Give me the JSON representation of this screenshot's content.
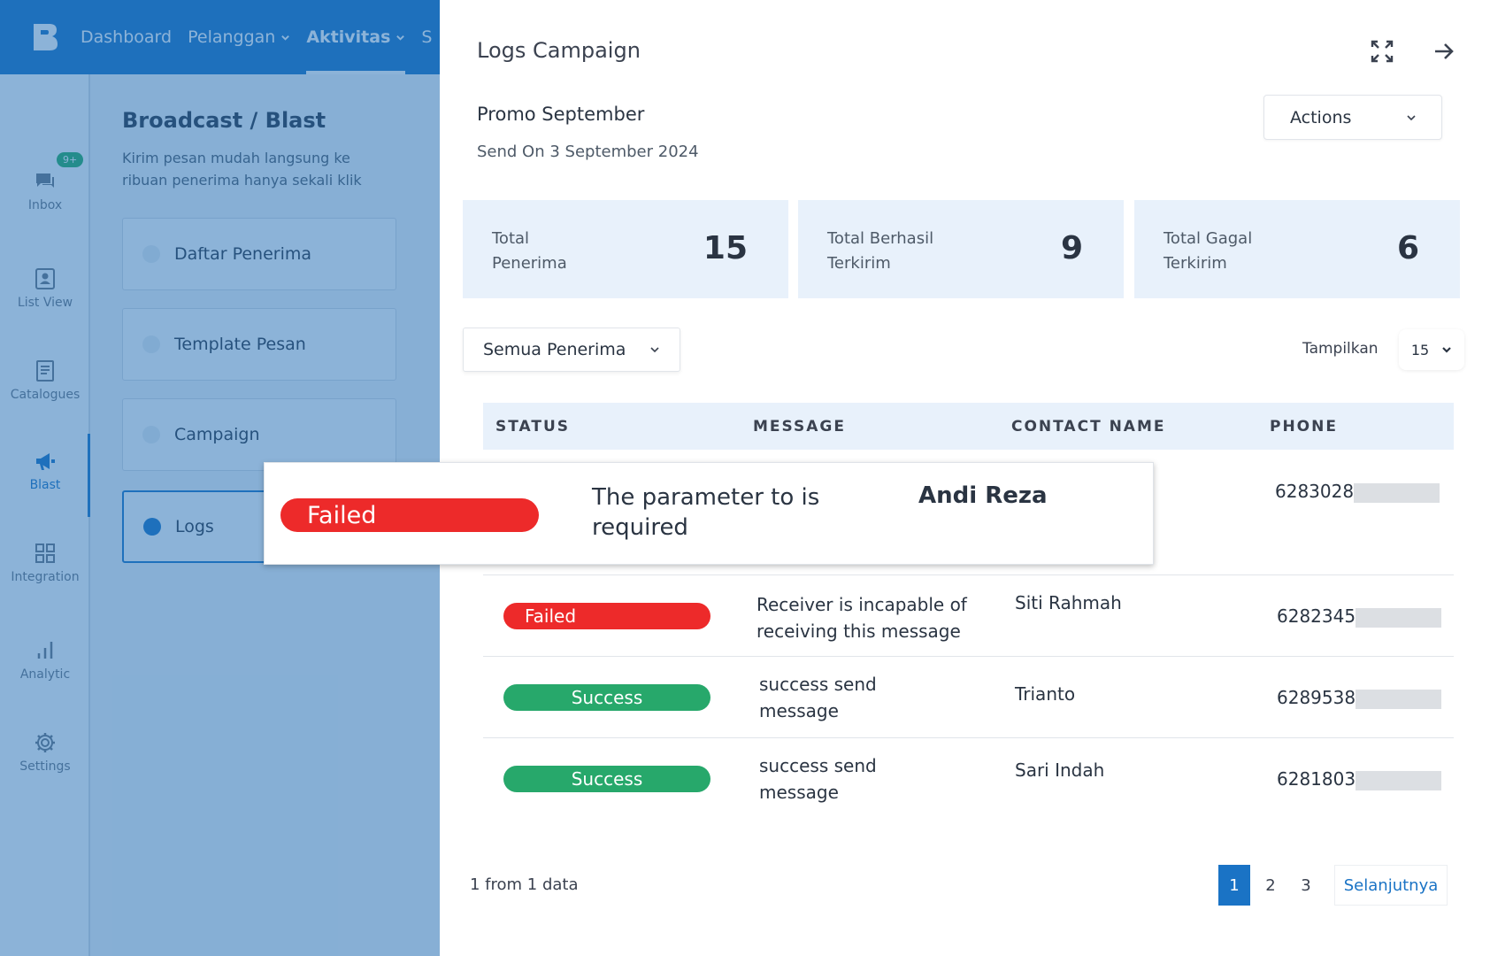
{
  "topbar": {
    "nav": [
      {
        "label": "Dashboard"
      },
      {
        "label": "Pelanggan"
      },
      {
        "label": "Aktivitas"
      },
      {
        "label": "S"
      }
    ]
  },
  "sidebar": {
    "items": [
      {
        "label": "Inbox",
        "icon": "chat-icon",
        "badge": "9+"
      },
      {
        "label": "List View",
        "icon": "contact-card-icon"
      },
      {
        "label": "Catalogues",
        "icon": "book-icon"
      },
      {
        "label": "Blast",
        "icon": "megaphone-icon"
      },
      {
        "label": "Integration",
        "icon": "grid-icon"
      },
      {
        "label": "Analytic",
        "icon": "bar-chart-icon"
      },
      {
        "label": "Settings",
        "icon": "gear-icon"
      }
    ]
  },
  "panel": {
    "title": "Broadcast / Blast",
    "description": "Kirim pesan mudah langsung ke ribuan penerima hanya sekali klik",
    "menu": [
      {
        "label": "Daftar Penerima"
      },
      {
        "label": "Template Pesan"
      },
      {
        "label": "Campaign"
      },
      {
        "label": "Logs"
      }
    ]
  },
  "drawer": {
    "title": "Logs Campaign",
    "campaign_name": "Promo September",
    "send_date": "Send On 3 September 2024",
    "actions_label": "Actions",
    "stats": [
      {
        "label_line1": "Total",
        "label_line2": "Penerima",
        "value": "15"
      },
      {
        "label_line1": "Total Berhasil",
        "label_line2": "Terkirim",
        "value": "9"
      },
      {
        "label_line1": "Total Gagal",
        "label_line2": "Terkirim",
        "value": "6"
      }
    ],
    "filter_label": "Semua Penerima",
    "tampilkan_label": "Tampilkan",
    "per_page": "15",
    "columns": [
      "STATUS",
      "MESSAGE",
      "CONTACT NAME",
      "PHONE"
    ],
    "rows": [
      {
        "status": "Failed",
        "message": "The parameter to is required",
        "contact": "Andi Reza",
        "phone": "6283028"
      },
      {
        "status": "Failed",
        "message": "Receiver is incapable of receiving this message",
        "contact": "Siti Rahmah",
        "phone": "6282345"
      },
      {
        "status": "Success",
        "message": "success send message",
        "contact": "Trianto",
        "phone": "6289538"
      },
      {
        "status": "Success",
        "message": "success send message",
        "contact": "Sari Indah",
        "phone": "6281803"
      }
    ],
    "footer_info": "1 from 1 data",
    "pages": [
      "1",
      "2",
      "3"
    ],
    "next_label": "Selanjutnya"
  },
  "colors": {
    "brand": "#1a73c5",
    "failed": "#ed2a2a",
    "success": "#27a86b",
    "stat_bg": "#e8f1fb"
  }
}
